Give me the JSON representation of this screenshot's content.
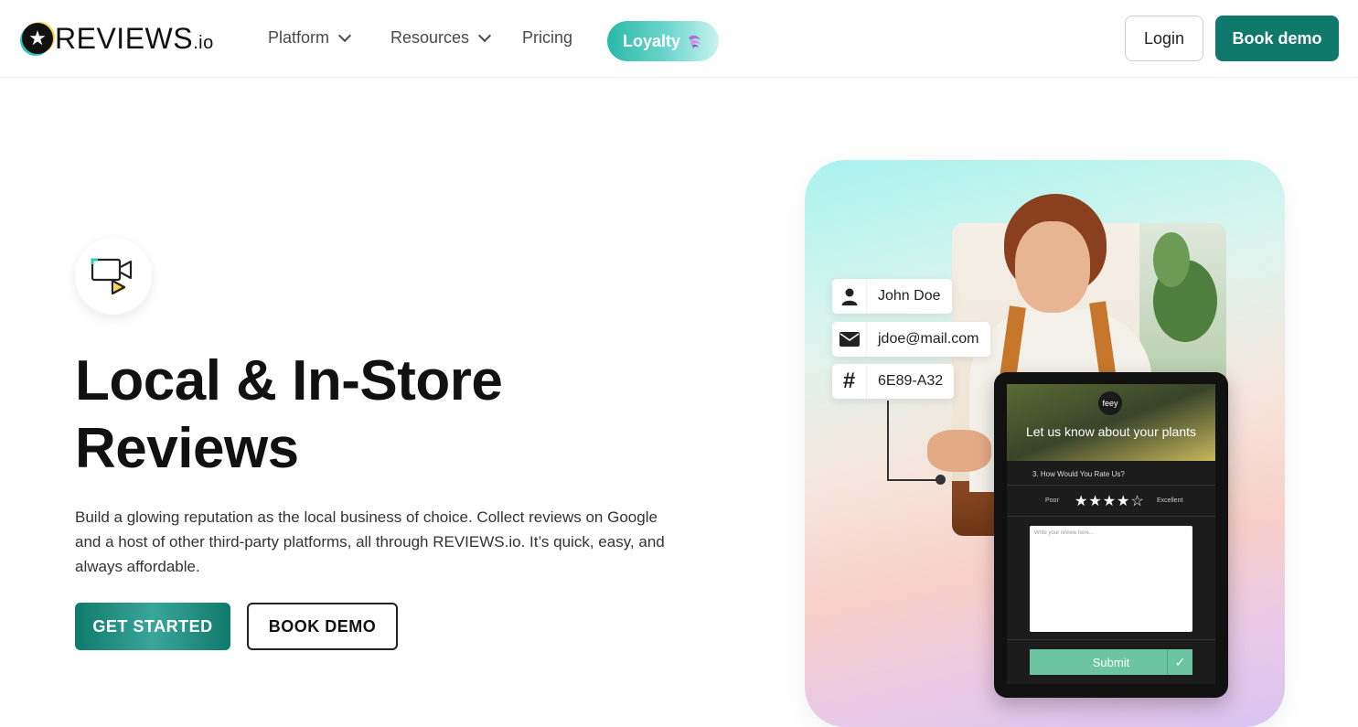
{
  "nav": {
    "logo_main": "REVIEWS",
    "logo_suffix": ".io",
    "items": [
      {
        "label": "Platform",
        "has_dropdown": true
      },
      {
        "label": "Resources",
        "has_dropdown": true
      },
      {
        "label": "Pricing",
        "has_dropdown": false
      }
    ],
    "loyalty_label": "Loyalty",
    "login_label": "Login",
    "book_demo_label": "Book demo"
  },
  "hero": {
    "icon": "video-review-icon",
    "title_line1": "Local & In-Store",
    "title_line2": "Reviews",
    "description": "Build a glowing reputation as the local business of choice. Collect reviews on Google and a host of other third-party platforms, all through REVIEWS.io. It’s quick, easy, and always affordable.",
    "cta_primary": "GET STARTED",
    "cta_secondary": "BOOK DEMO"
  },
  "illustration": {
    "fields": [
      {
        "icon": "person-icon",
        "value": "John Doe"
      },
      {
        "icon": "mail-icon",
        "value": "jdoe@mail.com"
      },
      {
        "icon": "hash-icon",
        "value": "6E89-A32"
      }
    ],
    "tablet": {
      "brand": "feey",
      "headline": "Let us know about your plants",
      "question": "3. How Would You Rate Us?",
      "rating_low": "Poor",
      "rating_high": "Excellent",
      "rating": 4,
      "rating_max": 5,
      "textarea_placeholder": "Write your review here...",
      "submit_label": "Submit"
    }
  },
  "colors": {
    "brand_teal": "#0f7a6c",
    "loyalty_gradient_start": "#2bb8a8",
    "text_dark": "#111111"
  }
}
